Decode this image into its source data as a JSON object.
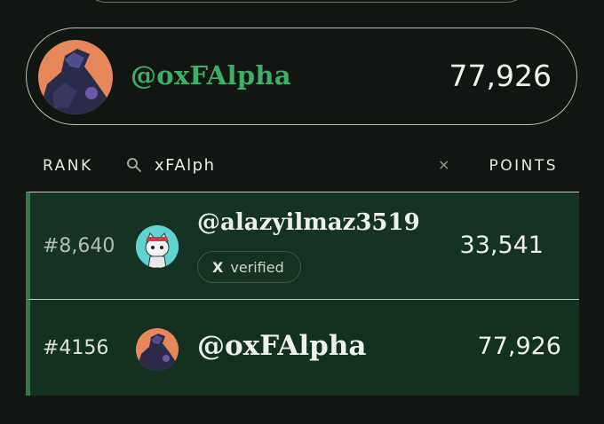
{
  "current_user": {
    "handle": "@oxFAlpha",
    "points": "77,926"
  },
  "table_header": {
    "rank_label": "RANK",
    "search_value": "xFAlph",
    "clear_symbol": "×",
    "points_label": "POINTS"
  },
  "rows": [
    {
      "rank": "#8,640",
      "handle": "@alazyilmaz3519",
      "badge_icon": "X",
      "badge_label": "verified",
      "points": "33,541"
    },
    {
      "rank": "#4156",
      "handle": "@oxFAlpha",
      "points": "77,926"
    }
  ],
  "colors": {
    "accent_green": "#3fae6a",
    "row_background": "#163222",
    "page_background": "#121612"
  }
}
